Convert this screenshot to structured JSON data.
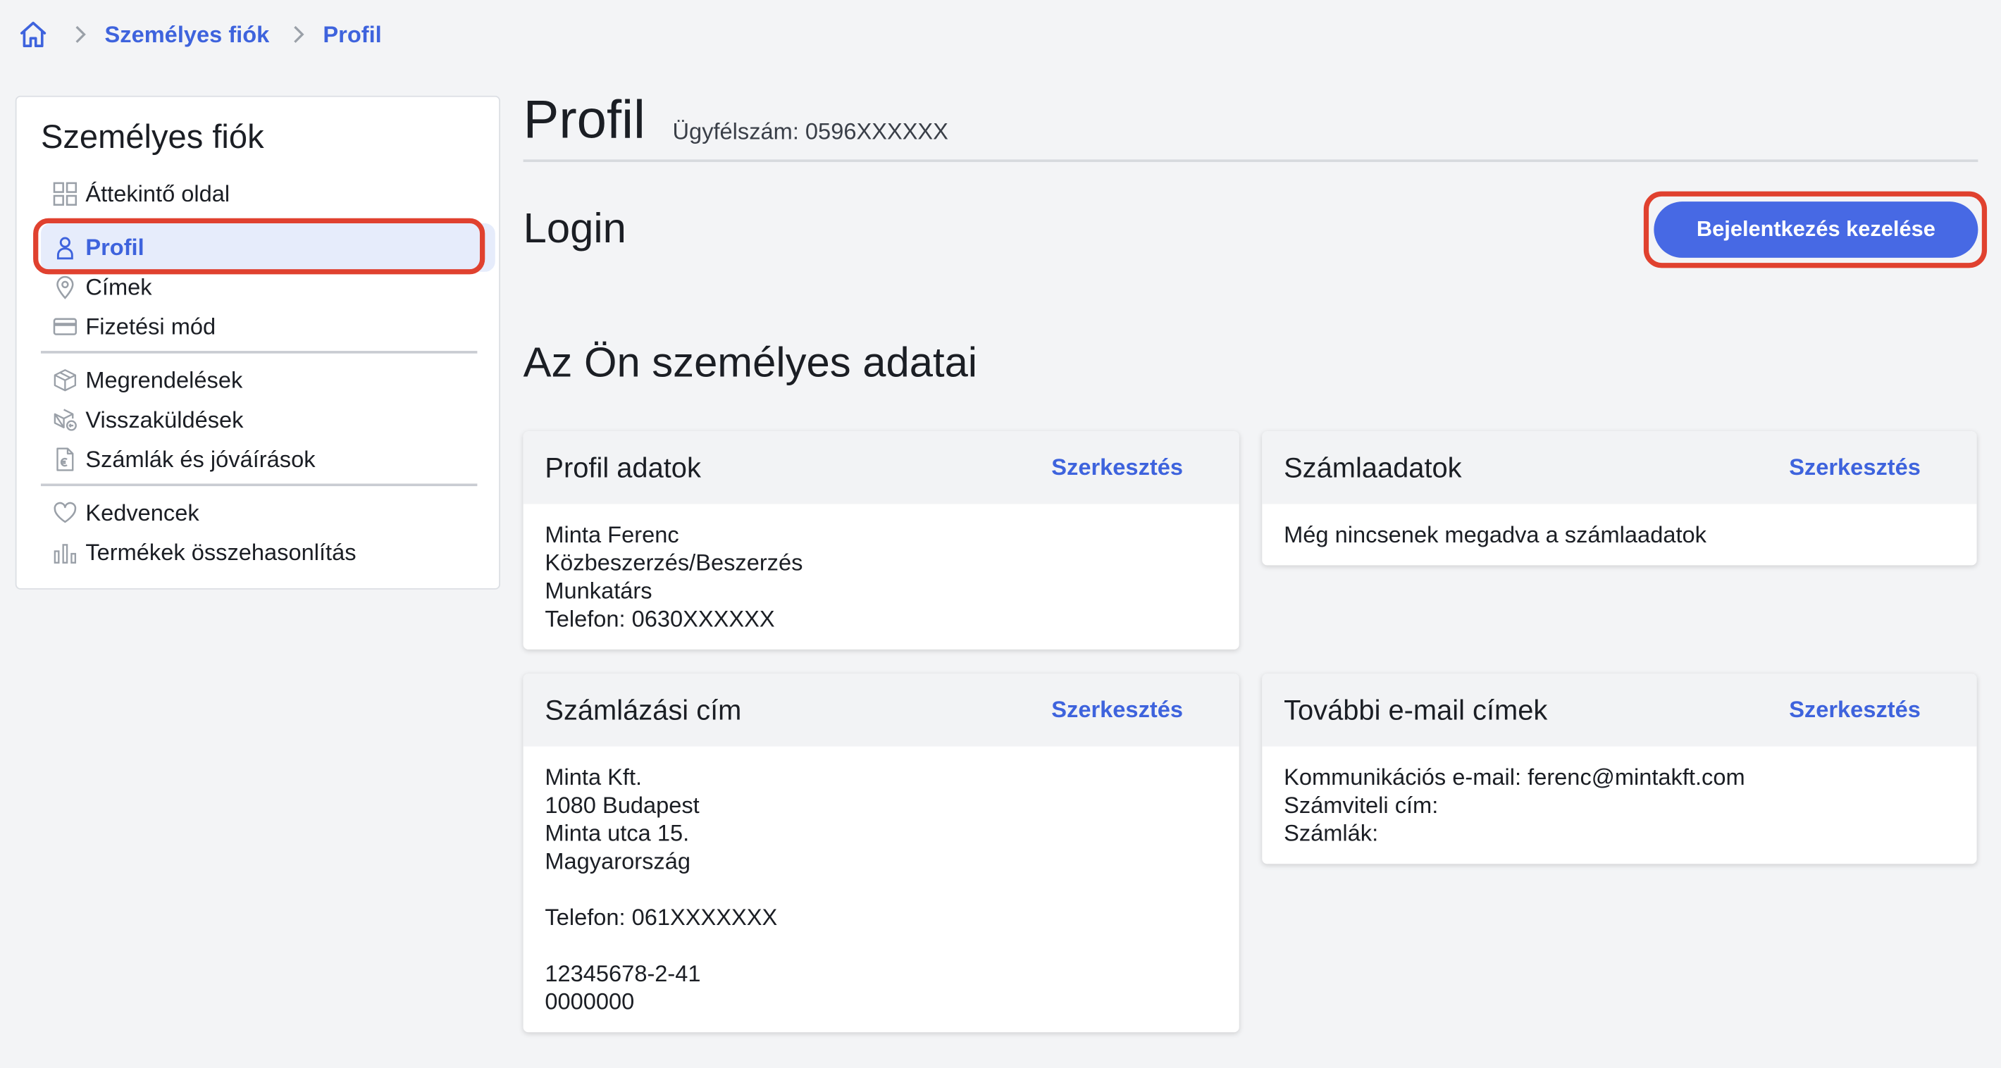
{
  "breadcrumb": {
    "home_icon": "home-icon",
    "items": [
      "Személyes fiók",
      "Profil"
    ]
  },
  "sidebar": {
    "title": "Személyes fiók",
    "groups": [
      [
        {
          "label": "Áttekintő oldal",
          "icon": "grid-icon"
        },
        {
          "label": "Profil",
          "icon": "user-icon",
          "active": true
        },
        {
          "label": "Címek",
          "icon": "map-pin-icon"
        },
        {
          "label": "Fizetési mód",
          "icon": "credit-card-icon"
        }
      ],
      [
        {
          "label": "Megrendelések",
          "icon": "box-icon"
        },
        {
          "label": "Visszaküldések",
          "icon": "return-box-icon"
        },
        {
          "label": "Számlák és jóváírások",
          "icon": "invoice-icon"
        }
      ],
      [
        {
          "label": "Kedvencek",
          "icon": "heart-icon"
        },
        {
          "label": "Termékek összehasonlítás",
          "icon": "bar-chart-icon"
        }
      ]
    ]
  },
  "main": {
    "title": "Profil",
    "customer_number": "Ügyfélszám: 0596XXXXXX",
    "login_title": "Login",
    "login_button": "Bejelentkezés kezelése",
    "section_title": "Az Ön személyes adatai",
    "cards": [
      {
        "title": "Profil adatok",
        "edit": "Szerkesztés",
        "lines": [
          "Minta Ferenc",
          "Közbeszerzés/Beszerzés",
          "Munkatárs",
          "Telefon: 0630XXXXXX"
        ]
      },
      {
        "title": "Számlaadatok",
        "edit": "Szerkesztés",
        "lines": [
          "Még nincsenek megadva a számlaadatok"
        ]
      },
      {
        "title": "Számlázási cím",
        "edit": "Szerkesztés",
        "lines": [
          "Minta Kft.",
          "1080 Budapest",
          "Minta utca 15.",
          "Magyarország",
          "",
          "Telefon: 061XXXXXXX",
          "",
          "12345678-2-41",
          "0000000"
        ]
      },
      {
        "title": "További e-mail címek",
        "edit": "Szerkesztés",
        "lines": [
          "Kommunikációs e-mail: ferenc@mintakft.com",
          "Számviteli cím:",
          "Számlák:"
        ]
      }
    ]
  },
  "colors": {
    "accent": "#3e63dd",
    "button": "#4769e4",
    "highlight": "#e0412f",
    "active_bg": "#e6ecfb"
  }
}
